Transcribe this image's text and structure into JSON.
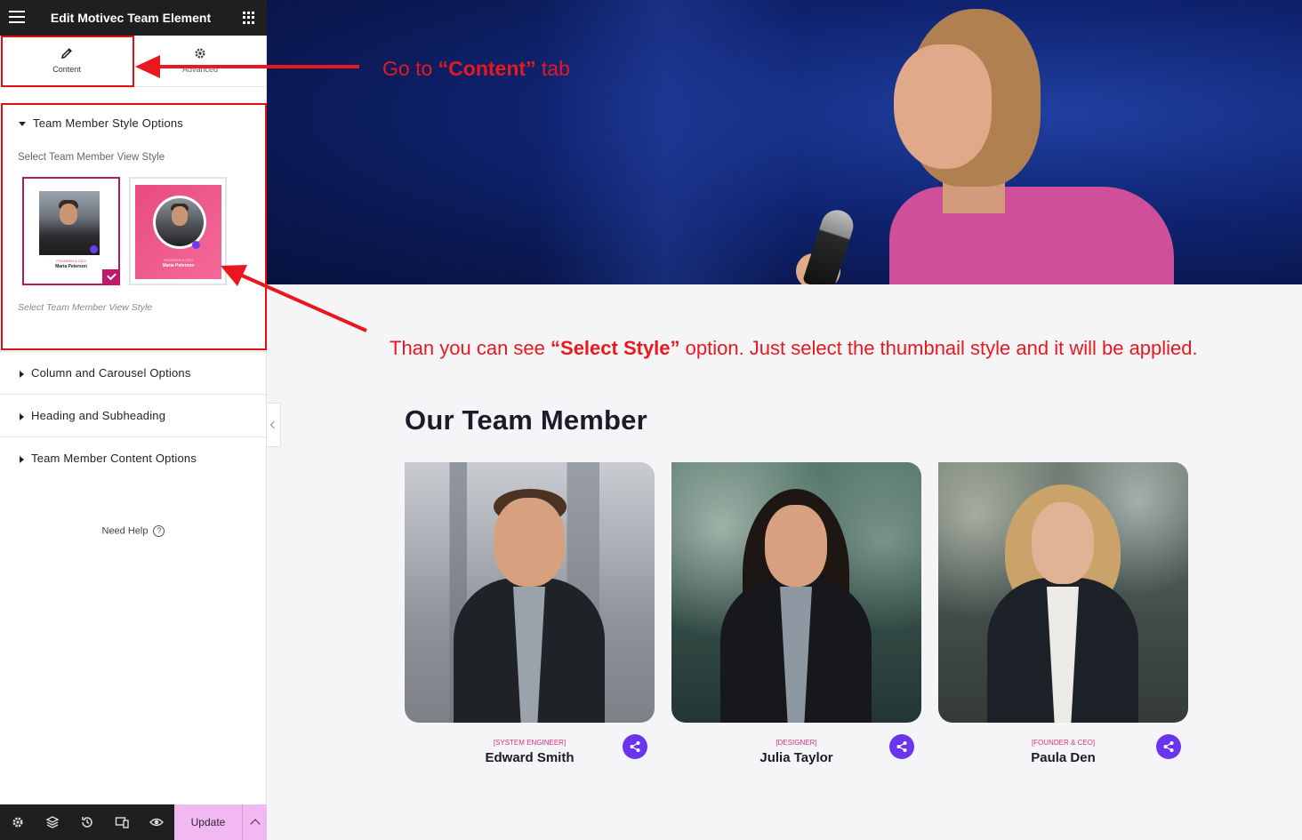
{
  "editor": {
    "title": "Edit Motivec Team Element",
    "tabs": [
      {
        "label": "Content",
        "icon": "pencil-icon"
      },
      {
        "label": "Advanced",
        "icon": "gear-icon"
      }
    ],
    "sections": [
      {
        "label": "Team Member Style Options",
        "expanded": true
      },
      {
        "label": "Column and Carousel Options",
        "expanded": false
      },
      {
        "label": "Heading and Subheading",
        "expanded": false
      },
      {
        "label": "Team Member Content Options",
        "expanded": false
      }
    ],
    "style_selector": {
      "label": "Select Team Member View Style",
      "note": "Select Team Member View Style",
      "thumbnails": [
        {
          "role": "FOUNDER & CEO",
          "name": "Maria Peterson",
          "selected": true
        },
        {
          "role": "FOUNDER & CEO",
          "name": "Maria Peterson",
          "selected": false
        }
      ]
    },
    "help": "Need Help",
    "footer": {
      "icons": [
        "settings-icon",
        "layers-icon",
        "history-icon",
        "responsive-icon",
        "preview-eye-icon"
      ],
      "update_label": "Update"
    }
  },
  "annotations": {
    "step1": {
      "pre": "Go  to ",
      "bold": "“Content”",
      "post": " tab"
    },
    "step2": {
      "pre": "Than you can see ",
      "bold": "“Select Style”",
      "post": " option. Just select the thumbnail style and it will be applied."
    },
    "color": "#e8181e"
  },
  "team": {
    "heading": "Our Team Member",
    "members": [
      {
        "role": "[SYSTEM ENGINEER]",
        "name": "Edward Smith"
      },
      {
        "role": "[DESIGNER]",
        "name": "Julia Taylor"
      },
      {
        "role": "[FOUNDER & CEO]",
        "name": "Paula Den"
      }
    ]
  },
  "colors": {
    "accent_pink": "#c0186d",
    "share_purple": "#6a35ef",
    "update_button": "#f2b8f2",
    "topbar": "#1f1f1f"
  }
}
